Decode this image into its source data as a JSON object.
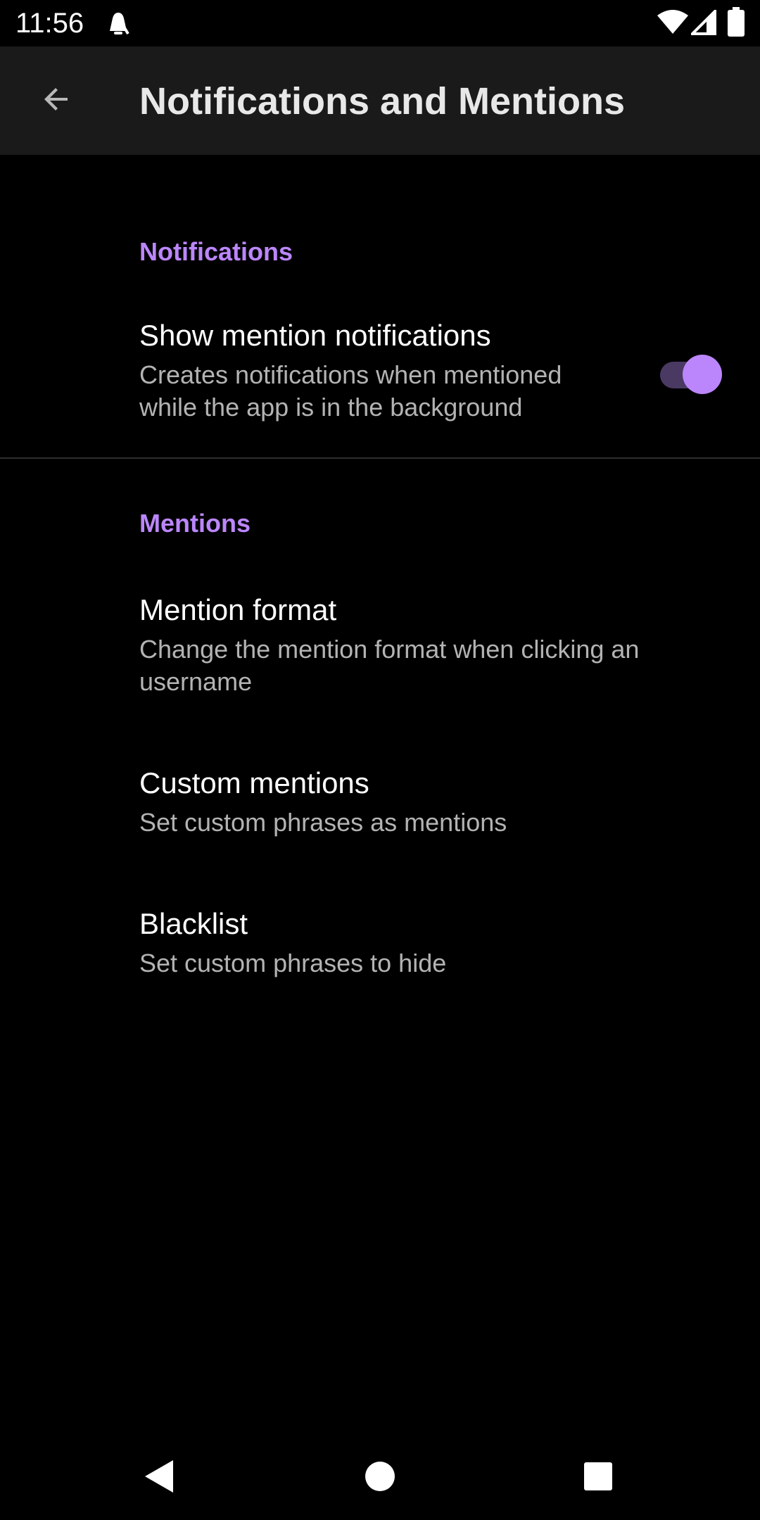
{
  "status_bar": {
    "time": "11:56",
    "icons": [
      "notification-icon",
      "wifi-icon",
      "signal-icon",
      "battery-icon"
    ]
  },
  "app_bar": {
    "title": "Notifications and Mentions",
    "back_icon": "arrow-back-icon"
  },
  "sections": {
    "notifications": {
      "header": "Notifications",
      "items": [
        {
          "title": "Show mention notifications",
          "summary_line1": "Creates notifications when mentioned",
          "summary_line2": "while the app is in the background",
          "toggle_on": true
        }
      ]
    },
    "mentions": {
      "header": "Mentions",
      "items": [
        {
          "title": "Mention format",
          "summary_line1": "Change the mention format when clicking an",
          "summary_line2": "username"
        },
        {
          "title": "Custom mentions",
          "summary_line1": "Set custom phrases as mentions"
        },
        {
          "title": "Blacklist",
          "summary_line1": "Set custom phrases to hide"
        }
      ]
    }
  },
  "nav_bar": {
    "icons": [
      "nav-back-icon",
      "nav-home-icon",
      "nav-recents-icon"
    ]
  },
  "colors": {
    "accent": "#bb86fc",
    "background": "#000000",
    "app_bar": "#1a1a1a",
    "summary_text": "#b3b3b3",
    "switch_track": "#4a3a63"
  }
}
